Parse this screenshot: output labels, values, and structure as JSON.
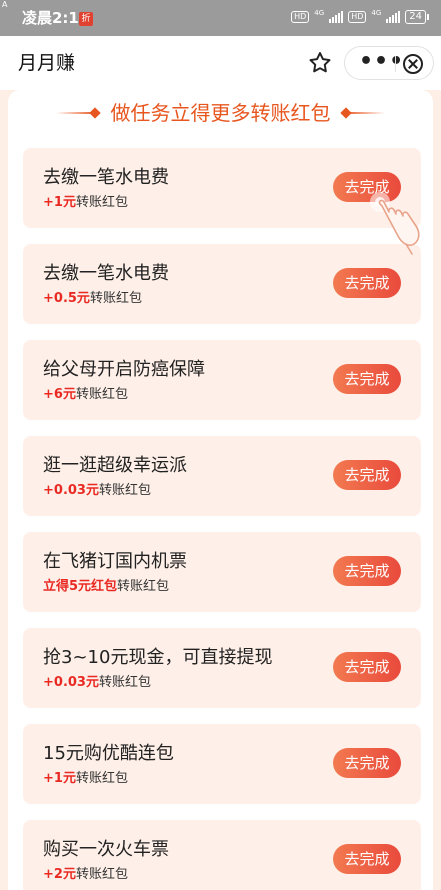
{
  "status_bar": {
    "carrier_mark": "A",
    "time": "凌晨2:11",
    "app_badge": "折",
    "network_1": "4G",
    "network_2": "4G",
    "hd_label": "HD",
    "battery": "24"
  },
  "nav": {
    "title": "月月赚",
    "more_icon": "more-dots-icon",
    "close_icon": "close-circle-icon",
    "favorite_icon": "star-outline-icon"
  },
  "heading": "做任务立得更多转账红包",
  "colors": {
    "accent": "#e8561f",
    "reward_red": "#e82a23",
    "button_start": "#f27a50",
    "button_end": "#e94a3c",
    "card_bg": "#fef0e8"
  },
  "tasks": [
    {
      "name": "去缴一笔水电费",
      "amount": "+1元",
      "suffix": "转账红包",
      "action": "去完成"
    },
    {
      "name": "去缴一笔水电费",
      "amount": "+0.5元",
      "suffix": "转账红包",
      "action": "去完成"
    },
    {
      "name": "给父母开启防癌保障",
      "amount": "+6元",
      "suffix": "转账红包",
      "action": "去完成"
    },
    {
      "name": "逛一逛超级幸运派",
      "amount": "+0.03元",
      "suffix": "转账红包",
      "action": "去完成"
    },
    {
      "name": "在飞猪订国内机票",
      "amount": "立得5元红包",
      "suffix": "转账红包",
      "action": "去完成"
    },
    {
      "name": "抢3~10元现金，可直接提现",
      "amount": "+0.03元",
      "suffix": "转账红包",
      "action": "去完成"
    },
    {
      "name": "15元购优酷连包",
      "amount": "+1元",
      "suffix": "转账红包",
      "action": "去完成"
    },
    {
      "name": "购买一次火车票",
      "amount": "+2元",
      "suffix": "转账红包",
      "action": "去完成"
    }
  ]
}
